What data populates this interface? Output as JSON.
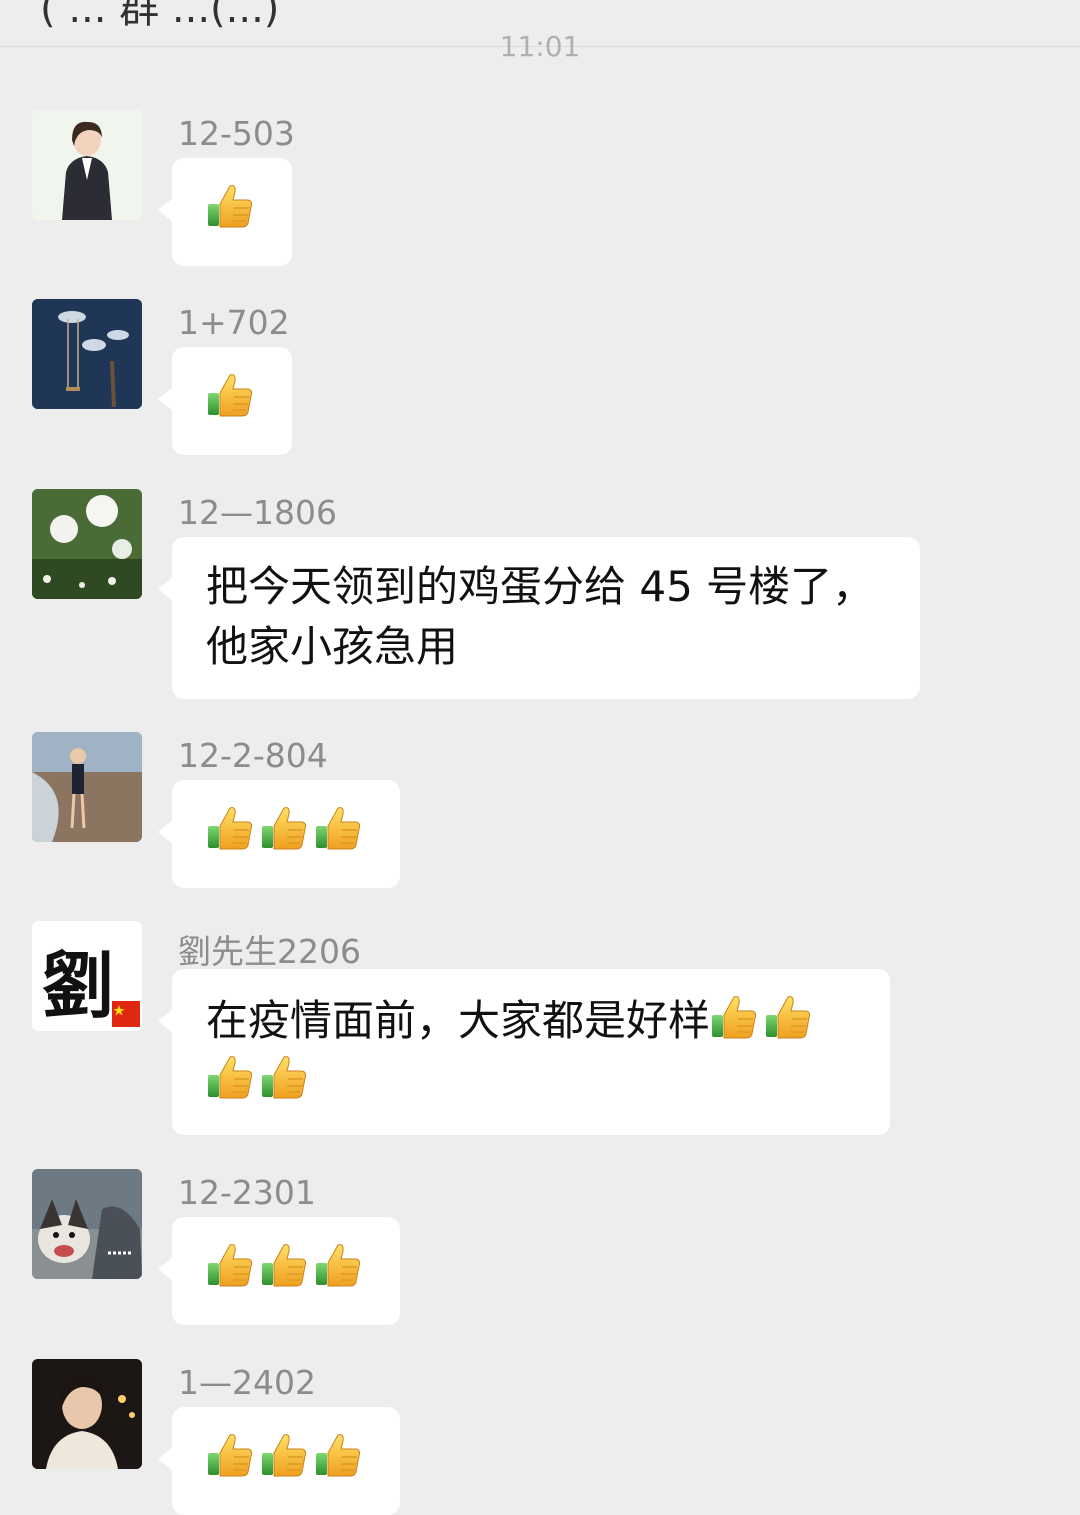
{
  "header": {
    "title": "( ... 群 ...(...)"
  },
  "timestamp": "11:01",
  "messages": [
    {
      "sender": "12-503",
      "thumbs": [
        1
      ]
    },
    {
      "sender": "1+702",
      "thumbs": [
        1
      ]
    },
    {
      "sender": "12—1806",
      "text_line1": "把今天领到的鸡蛋分给 45 号楼了，",
      "text_line2": "他家小孩急用"
    },
    {
      "sender": "12-2-804",
      "thumbs": [
        1,
        1,
        1
      ]
    },
    {
      "sender": "劉先生2206",
      "text": "在疫情面前，大家都是好样",
      "avatar_text": "劉"
    },
    {
      "sender": "12-2301",
      "thumbs": [
        1,
        1,
        1
      ]
    },
    {
      "sender": "1—2402",
      "thumbs": [
        1,
        1,
        1
      ]
    }
  ],
  "colors": {
    "background": "#ededed",
    "bubble": "#ffffff",
    "sender_name": "#8c8c8c",
    "timestamp": "#b0b0b0"
  },
  "icons": [
    "thumbs-up-icon",
    "china-flag-icon"
  ]
}
